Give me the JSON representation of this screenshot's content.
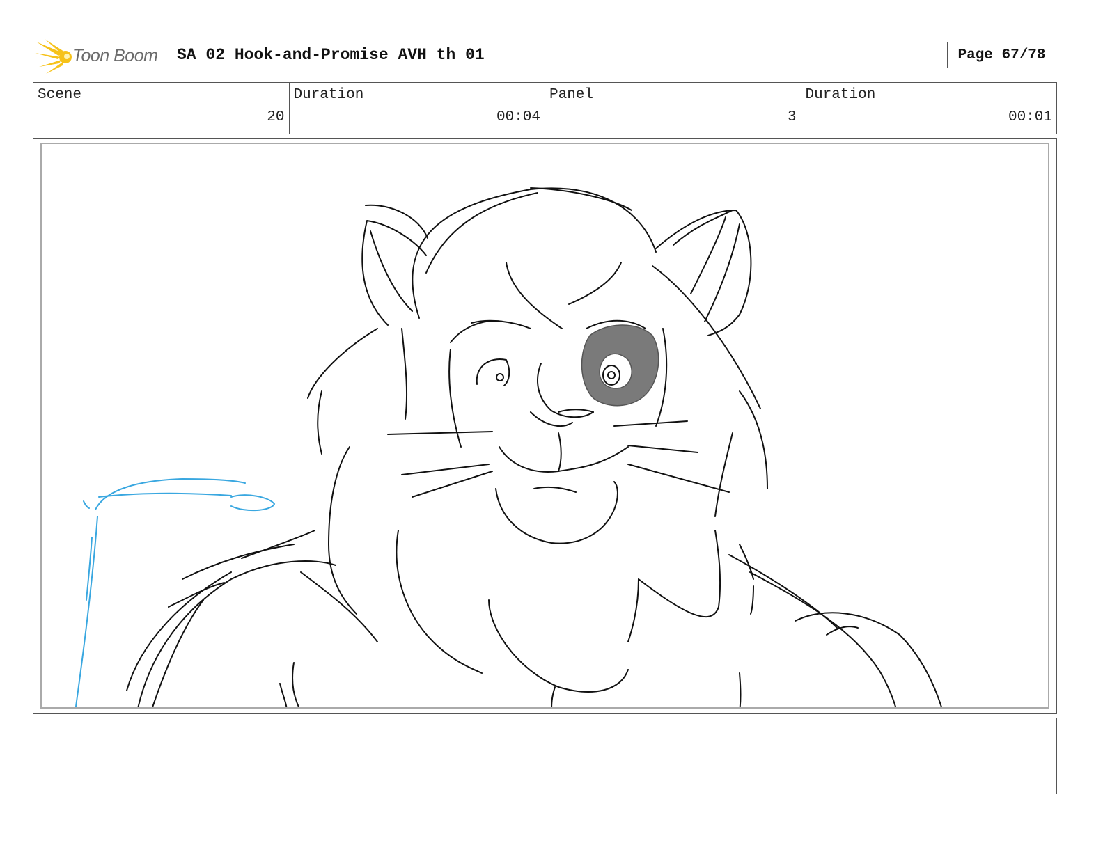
{
  "header": {
    "logo_text": "Toon Boom",
    "title": "SA 02 Hook-and-Promise AVH th 01",
    "page": "Page 67/78"
  },
  "info": {
    "scene_label": "Scene",
    "scene_value": "20",
    "scene_duration_label": "Duration",
    "scene_duration_value": "00:04",
    "panel_label": "Panel",
    "panel_value": "3",
    "panel_duration_label": "Duration",
    "panel_duration_value": "00:01"
  },
  "notes": {
    "text": ""
  },
  "colors": {
    "logo_accent": "#f6c21a",
    "sketch_line": "#111111",
    "guide_line": "#39a7e0",
    "eye_patch": "#7a7a7a"
  }
}
